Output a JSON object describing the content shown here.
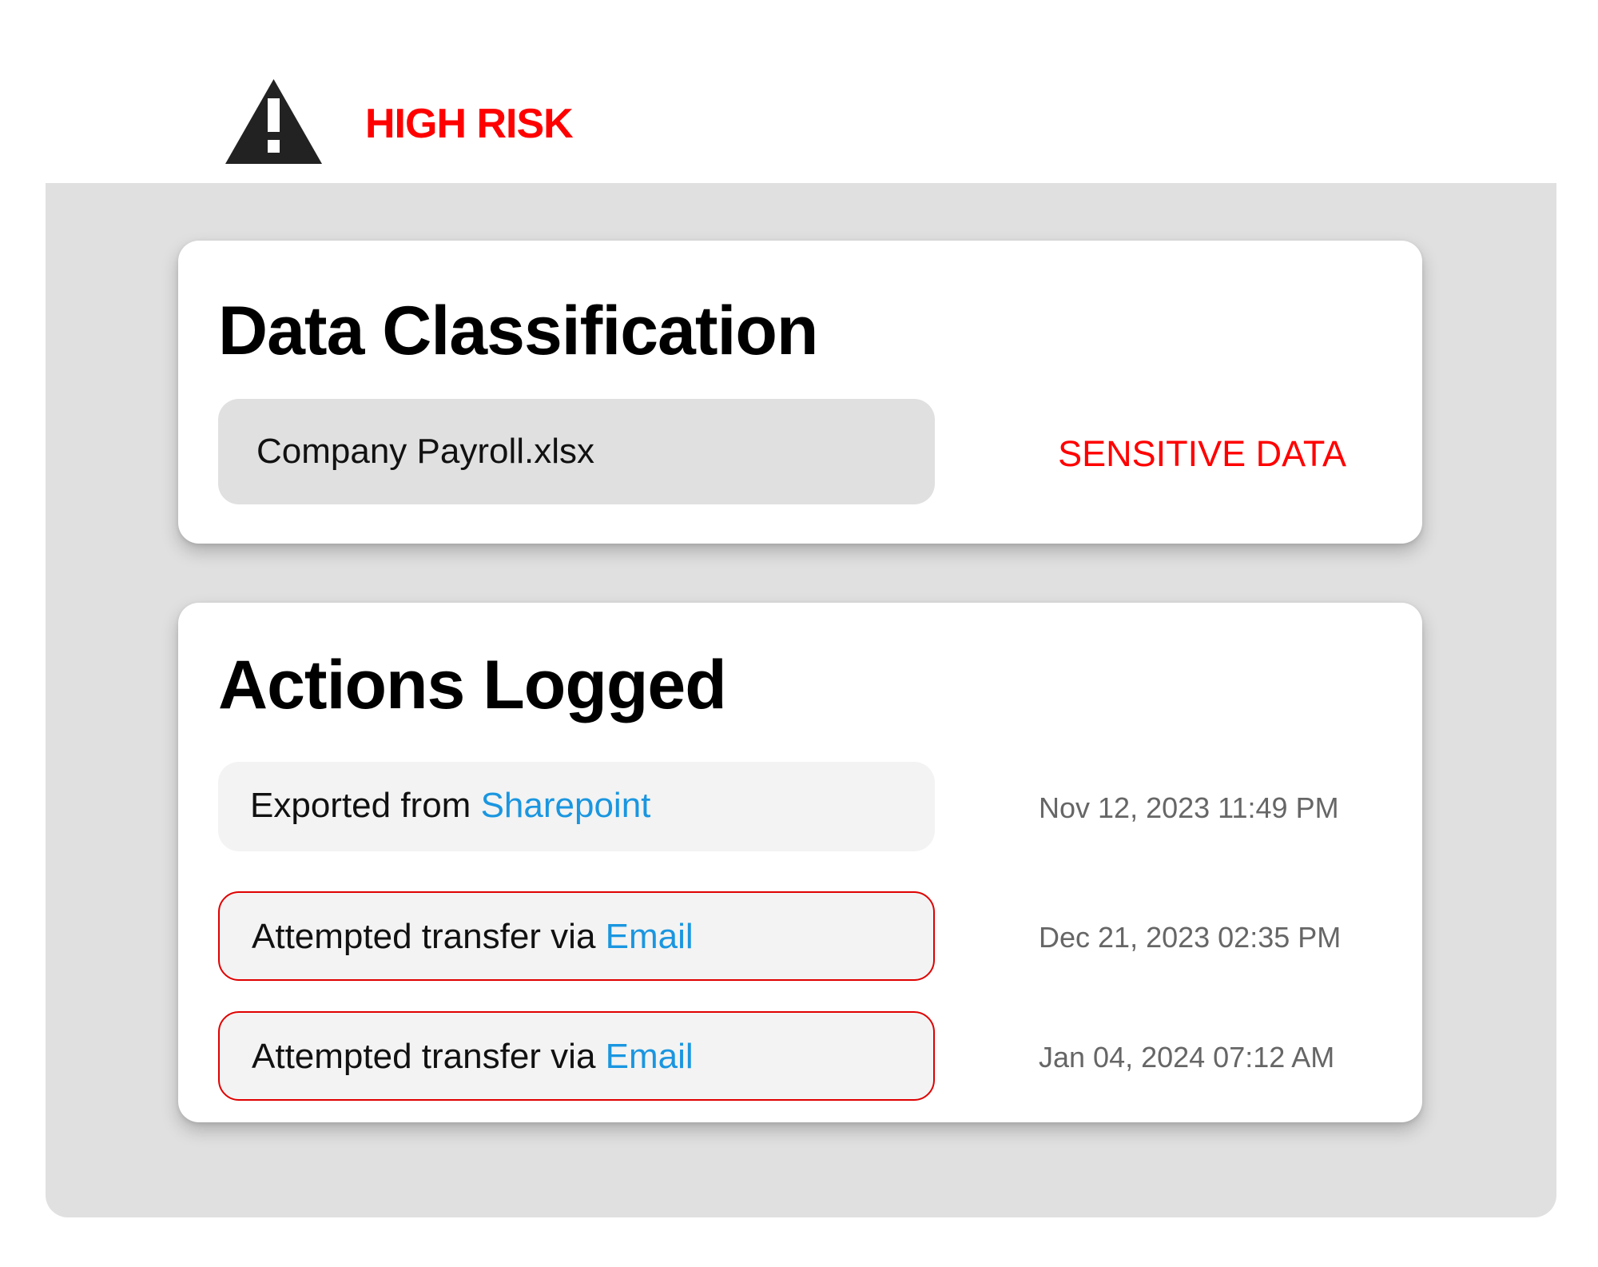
{
  "header": {
    "risk_label": "HIGH RISK",
    "risk_color": "#ff0000",
    "icon": "warning-icon"
  },
  "classification": {
    "title": "Data Classification",
    "file_name": "Company Payroll.xlsx",
    "tag": "SENSITIVE DATA",
    "tag_color": "#ff0000"
  },
  "actions": {
    "title": "Actions Logged",
    "link_color": "#1a96e0",
    "flag_color": "#e00000",
    "items": [
      {
        "text": "Exported from",
        "link": "Sharepoint",
        "timestamp": "Nov 12, 2023 11:49 PM",
        "flagged": false
      },
      {
        "text": "Attempted transfer via",
        "link": "Email",
        "timestamp": "Dec 21, 2023 02:35 PM",
        "flagged": true
      },
      {
        "text": "Attempted transfer via",
        "link": "Email",
        "timestamp": "Jan 04, 2024 07:12 AM",
        "flagged": true
      }
    ]
  }
}
